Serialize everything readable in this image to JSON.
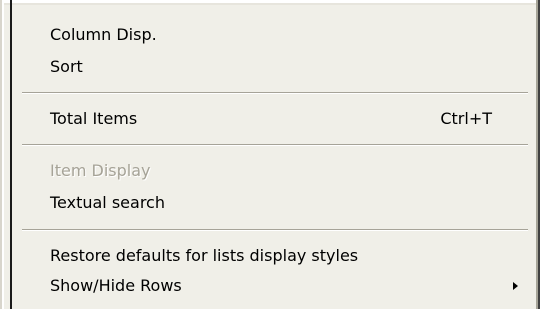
{
  "menu": {
    "groups": [
      {
        "items": [
          {
            "label": "Column Disp.",
            "shortcut": "",
            "enabled": true,
            "submenu": false
          },
          {
            "label": "Sort",
            "shortcut": "",
            "enabled": true,
            "submenu": false
          }
        ]
      },
      {
        "items": [
          {
            "label": "Total Items",
            "shortcut": "Ctrl+T",
            "enabled": true,
            "submenu": false
          }
        ]
      },
      {
        "items": [
          {
            "label": "Item Display",
            "shortcut": "",
            "enabled": false,
            "submenu": false
          },
          {
            "label": "Textual search",
            "shortcut": "",
            "enabled": true,
            "submenu": false
          }
        ]
      },
      {
        "items": [
          {
            "label": "Restore defaults for lists display styles",
            "shortcut": "",
            "enabled": true,
            "submenu": false
          },
          {
            "label": "Show/Hide Rows",
            "shortcut": "",
            "enabled": true,
            "submenu": true
          }
        ]
      }
    ]
  },
  "colors": {
    "menu_background": "#f0efe8",
    "text": "#000000",
    "disabled_text": "#a6a397"
  }
}
